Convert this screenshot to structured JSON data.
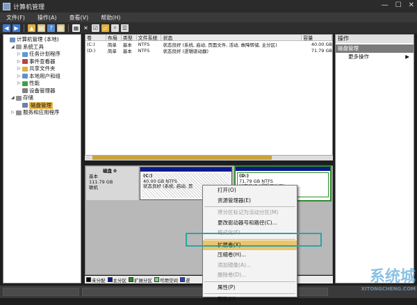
{
  "title": "计算机管理",
  "menu": [
    "文件(F)",
    "操作(A)",
    "查看(V)",
    "帮助(H)"
  ],
  "tree": [
    {
      "label": "计算机管理 (本地)",
      "level": 0,
      "expander": "",
      "icon": "computer-icon"
    },
    {
      "label": "系统工具",
      "level": 1,
      "expander": "◢",
      "icon": "tools-icon"
    },
    {
      "label": "任务计划程序",
      "level": 2,
      "expander": "▷",
      "icon": "clock-icon"
    },
    {
      "label": "事件查看器",
      "level": 2,
      "expander": "▷",
      "icon": "event-icon"
    },
    {
      "label": "共享文件夹",
      "level": 2,
      "expander": "▷",
      "icon": "folder-icon"
    },
    {
      "label": "本地用户和组",
      "level": 2,
      "expander": "▷",
      "icon": "users-icon"
    },
    {
      "label": "性能",
      "level": 2,
      "expander": "▷",
      "icon": "performance-icon"
    },
    {
      "label": "设备管理器",
      "level": 2,
      "expander": "",
      "icon": "device-icon"
    },
    {
      "label": "存储",
      "level": 1,
      "expander": "◢",
      "icon": "storage-icon"
    },
    {
      "label": "磁盘管理",
      "level": 2,
      "expander": "",
      "icon": "disk-icon",
      "selected": true
    },
    {
      "label": "服务和应用程序",
      "level": 1,
      "expander": "▷",
      "icon": "services-icon"
    }
  ],
  "volume_table": {
    "headers": [
      "卷",
      "布局",
      "类型",
      "文件系统",
      "状态",
      "容量"
    ],
    "rows": [
      [
        "(C:)",
        "简单",
        "基本",
        "NTFS",
        "状态良好 (系统, 启动, 页面文件, 活动, 故障转储, 主分区)",
        "40.00 GB"
      ],
      [
        "(D:)",
        "简单",
        "基本",
        "NTFS",
        "状态良好 (逻辑驱动器)",
        "71.79 GB"
      ]
    ]
  },
  "disk": {
    "name": "磁盘 0",
    "type": "基本",
    "size": "111.79 GB",
    "status": "联机"
  },
  "partition_c": {
    "name": "(C:)",
    "size": "40.00 GB NTFS",
    "status": "状态良好 (系统, 启动, 页"
  },
  "partition_d": {
    "name": "(D:)",
    "size": "71.79 GB NTFS",
    "status": "状态良好 (逻辑驱动器)"
  },
  "legend": [
    {
      "label": "未分配",
      "color": "#000000"
    },
    {
      "label": "主分区",
      "color": "#0b1a8a"
    },
    {
      "label": "扩展分区",
      "color": "#2e8b2e"
    },
    {
      "label": "可用空间",
      "color": "#7fd37f"
    },
    {
      "label": "逻",
      "color": "#2244cc"
    }
  ],
  "actions": {
    "header": "操作",
    "section": "磁盘管理",
    "more": "更多操作"
  },
  "context_menu": [
    {
      "label": "打开(O)",
      "enabled": true
    },
    {
      "label": "资源管理器(E)",
      "enabled": true
    },
    {
      "sep": true
    },
    {
      "label": "将分区标记为活动分区(M)",
      "enabled": false
    },
    {
      "label": "更改驱动器号和路径(C)...",
      "enabled": true
    },
    {
      "label": "格式化(F)...",
      "enabled": false
    },
    {
      "sep": true
    },
    {
      "label": "扩展卷(X)...",
      "enabled": true,
      "highlighted": true
    },
    {
      "label": "压缩卷(H)...",
      "enabled": true
    },
    {
      "label": "添加镜像(A)...",
      "enabled": false
    },
    {
      "label": "删除卷(D)...",
      "enabled": false
    },
    {
      "sep": true
    },
    {
      "label": "属性(P)",
      "enabled": true
    },
    {
      "sep": true
    },
    {
      "label": "帮助(H)",
      "enabled": true
    }
  ],
  "watermark": {
    "main": "系统城",
    "sub": "XITONGCHENG.COM"
  }
}
